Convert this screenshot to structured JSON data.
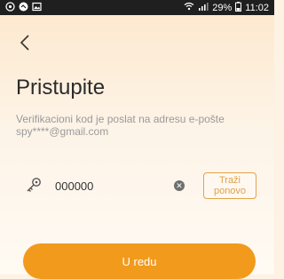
{
  "status_bar": {
    "battery": "29%",
    "time": "11:02",
    "icons": [
      "notification-icon",
      "app-icon",
      "image-icon",
      "wifi-icon",
      "signal-icon",
      "battery-icon"
    ]
  },
  "header": {
    "back_icon": "chevron-left-icon"
  },
  "title": "Pristupite",
  "info": {
    "line1": "Verifikacioni kod je poslat na adresu e-pošte",
    "line2": "spy****@gmail.com"
  },
  "code": {
    "value": "000000",
    "icon": "key-icon",
    "clear_icon": "clear-icon"
  },
  "resend": {
    "line1": "Traži",
    "line2": "ponovo"
  },
  "ok_button": "U redu",
  "colors": {
    "accent": "#f29a1b",
    "resend_border": "#e2a24b",
    "text_gray": "#9a9a9a",
    "title_text": "#2b2b2b"
  }
}
